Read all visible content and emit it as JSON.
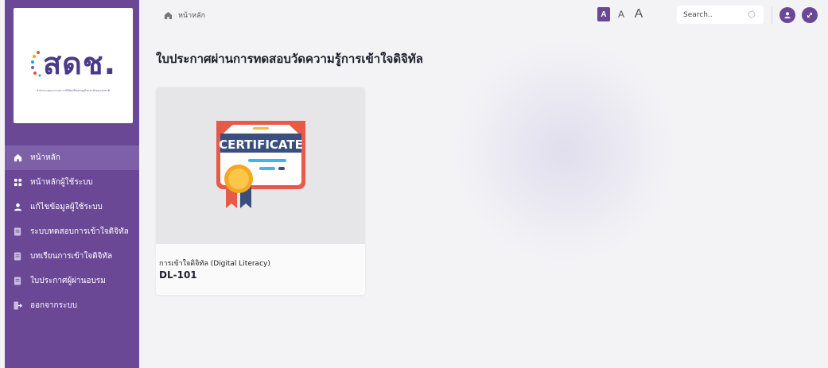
{
  "logo": {
    "text": "สดช.",
    "subtitle": "สำนักงานคณะกรรมการดิจิทัลเพื่อเศรษฐกิจและสังคมแห่งชาติ"
  },
  "sidebar": {
    "items": [
      {
        "label": "หน้าหลัก",
        "icon": "home-icon",
        "active": true
      },
      {
        "label": "หน้าหลักผู้ใช้ระบบ",
        "icon": "grid-icon",
        "active": false
      },
      {
        "label": "แก้ไขข้อมูลผู้ใช้ระบบ",
        "icon": "user-icon",
        "active": false
      },
      {
        "label": "ระบบทดสอบการเข้าใจดิจิทัล",
        "icon": "document-icon",
        "active": false
      },
      {
        "label": "บทเรียนการเข้าใจดิจิทัล",
        "icon": "document-icon",
        "active": false
      },
      {
        "label": "ใบประกาศผู้ผ่านอบรม",
        "icon": "document-icon",
        "active": false
      },
      {
        "label": "ออกจากระบบ",
        "icon": "logout-icon",
        "active": false
      }
    ]
  },
  "header": {
    "breadcrumb": "หน้าหลัก",
    "font_sizes": [
      "A",
      "A",
      "A"
    ],
    "search_placeholder": "Search.."
  },
  "main": {
    "title": "ใบประกาศผ่านการทดสอบวัดความรู้การเข้าใจดิจิทัล",
    "cards": [
      {
        "image_text": "CERTIFICATE",
        "title": "การเข้าใจดิจิทัล (Digital Literacy)",
        "code": "DL-101"
      }
    ]
  },
  "colors": {
    "sidebar": "#6a4896",
    "accent": "#6a4896",
    "background": "#f3f3f6"
  }
}
